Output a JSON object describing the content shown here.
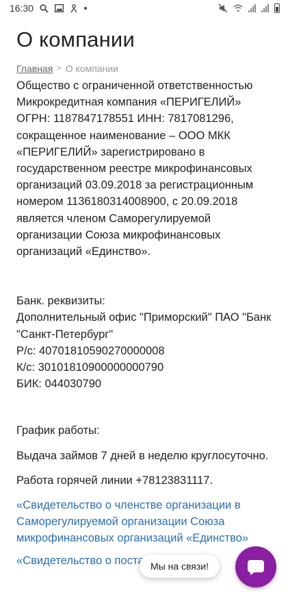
{
  "status_bar": {
    "time": "16:30",
    "icons": [
      "search-icon",
      "gallery-icon",
      "app-icon",
      "dot-icon",
      "mute-icon",
      "wifi-icon",
      "signal-icon",
      "signal-icon",
      "battery-icon"
    ]
  },
  "page": {
    "title": "О компании",
    "breadcrumb": {
      "home": "Главная",
      "separator": ">",
      "current": "О компании"
    }
  },
  "content": {
    "intro": "Общество с ограниченной ответственностью Микрокредитная компания «ПЕРИГЕЛИЙ» ОГРН: 1187847178551 ИНН: 7817081296, сокращенное наименование – ООО МКК «ПЕРИГЕЛИЙ» зарегистрировано в государственном реестре микрофинансовых организаций 03.09.2018 за регистрационным номером 1136180314008900, с 20.09.2018 является членом Саморегулируемой организации Союза микрофинансовых организаций «Единство».",
    "bank_title": "Банк. реквизиты:",
    "bank_office": "Дополнительный офис \"Приморский\" ПАО \"Банк \"Санкт-Петербург\"",
    "rs": "Р/с: 40701810590270000008",
    "ks": "К/с: 30101810900000000790",
    "bik": "БИК: 044030790",
    "schedule_title": "График работы:",
    "schedule_loans": "Выдача займов 7 дней в неделю круглосуточно.",
    "hotline": "Работа горячей линии +78123831117.",
    "link1": "«Свидетельство о членстве организации в Саморегулируемой организации Союза микрофинансовых организаций «Единство»",
    "link2": "«Свидетельство о постановке на учет"
  },
  "chat": {
    "bubble": "Мы на связи!",
    "button_icon": "chat-icon"
  },
  "colors": {
    "link": "#2a6fb5",
    "chat_button": "#8a1fa3"
  }
}
